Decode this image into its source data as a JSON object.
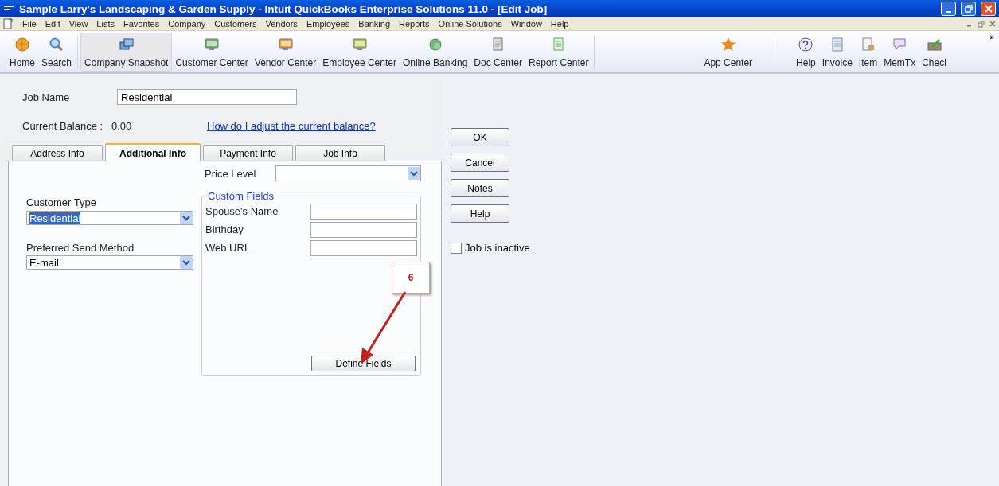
{
  "window": {
    "title": "Sample Larry's Landscaping & Garden Supply  - Intuit QuickBooks Enterprise Solutions 11.0 - [Edit Job]"
  },
  "menu": [
    "File",
    "Edit",
    "View",
    "Lists",
    "Favorites",
    "Company",
    "Customers",
    "Vendors",
    "Employees",
    "Banking",
    "Reports",
    "Online Solutions",
    "Window",
    "Help"
  ],
  "toolbar": [
    {
      "label": "Home",
      "kind": "home",
      "selected": false
    },
    {
      "label": "Search",
      "kind": "search",
      "selected": false
    },
    {
      "label": "Company Snapshot",
      "kind": "snapshot",
      "selected": true
    },
    {
      "label": "Customer Center",
      "kind": "customer",
      "selected": false
    },
    {
      "label": "Vendor Center",
      "kind": "vendor",
      "selected": false
    },
    {
      "label": "Employee Center",
      "kind": "employee",
      "selected": false
    },
    {
      "label": "Online Banking",
      "kind": "banking",
      "selected": false
    },
    {
      "label": "Doc Center",
      "kind": "doc",
      "selected": false
    },
    {
      "label": "Report Center",
      "kind": "report",
      "selected": false
    },
    {
      "label": "App Center",
      "kind": "app",
      "selected": false
    },
    {
      "label": "Help",
      "kind": "help",
      "selected": false
    },
    {
      "label": "Invoice",
      "kind": "invoice",
      "selected": false
    },
    {
      "label": "Item",
      "kind": "item",
      "selected": false
    },
    {
      "label": "MemTx",
      "kind": "memtx",
      "selected": false
    },
    {
      "label": "Checl",
      "kind": "check",
      "selected": false
    }
  ],
  "toolbar_overflow": "»",
  "form": {
    "job_name": {
      "label": "Job Name",
      "value": "Residential"
    },
    "current_balance": {
      "label": "Current Balance :",
      "value": "0.00"
    },
    "help_link": "How do I adjust the current balance?",
    "tabs": [
      {
        "label": "Address Info",
        "selected": false
      },
      {
        "label": "Additional Info",
        "selected": true
      },
      {
        "label": "Payment Info",
        "selected": false
      },
      {
        "label": "Job Info",
        "selected": false
      }
    ],
    "price_level": {
      "label": "Price Level"
    },
    "customer_type": {
      "label": "Customer Type",
      "value": "Residential",
      "text_selected": true
    },
    "send_method": {
      "label": "Preferred Send Method",
      "value": "E-mail"
    },
    "custom_fields": {
      "title": "Custom Fields",
      "fields": [
        {
          "label": "Spouse's Name"
        },
        {
          "label": "Birthday"
        },
        {
          "label": "Web URL"
        }
      ],
      "button": "Define Fields"
    },
    "buttons": [
      "OK",
      "Cancel",
      "Notes",
      "Help"
    ],
    "inactive": {
      "label": "Job is inactive",
      "checked": false
    }
  },
  "callout": {
    "label": "6"
  }
}
